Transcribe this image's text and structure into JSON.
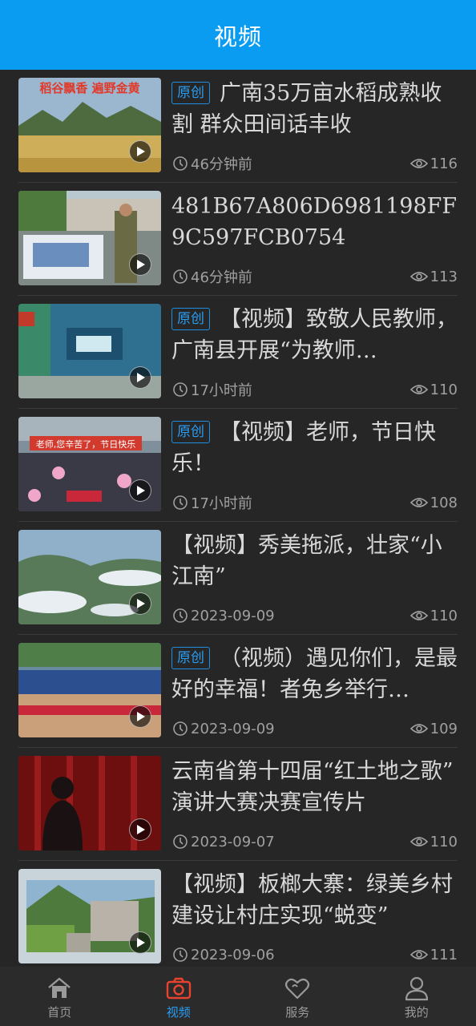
{
  "header": {
    "title": "视频"
  },
  "items": [
    {
      "tag": "原创",
      "title": "广南35万亩水稻成熟收割 群众田间话丰收",
      "time": "46分钟前",
      "views": "116",
      "thumb_text": "稻谷飘香 遍野金黄"
    },
    {
      "tag": "",
      "title": "481B67A806D6981198FF9C597FCB0754",
      "time": "46分钟前",
      "views": "113",
      "thumb_text": ""
    },
    {
      "tag": "原创",
      "title": "【视频】致敬人民教师，广南县开展“为教师…",
      "time": "17小时前",
      "views": "110",
      "thumb_text": ""
    },
    {
      "tag": "原创",
      "title": "【视频】老师，节日快乐！",
      "time": "17小时前",
      "views": "108",
      "thumb_text": "老师,您辛苦了，节日快乐"
    },
    {
      "tag": "",
      "title": "【视频】秀美拖派，壮家“小江南”",
      "time": "2023-09-09",
      "views": "110",
      "thumb_text": ""
    },
    {
      "tag": "原创",
      "title": "（视频）遇见你们，是最好的幸福！者兔乡举行…",
      "time": "2023-09-09",
      "views": "109",
      "thumb_text": ""
    },
    {
      "tag": "",
      "title": "云南省第十四届“红土地之歌” 演讲大赛决赛宣传片",
      "time": "2023-09-07",
      "views": "110",
      "thumb_text": ""
    },
    {
      "tag": "",
      "title": "【视频】板榔大寨：绿美乡村建设让村庄实现“蜕变”",
      "time": "2023-09-06",
      "views": "111",
      "thumb_text": ""
    }
  ],
  "tabbar": [
    {
      "label": "首页",
      "icon": "home-icon",
      "active": false
    },
    {
      "label": "视频",
      "icon": "camera-icon",
      "active": true
    },
    {
      "label": "服务",
      "icon": "heart-icon",
      "active": false
    },
    {
      "label": "我的",
      "icon": "user-icon",
      "active": false
    }
  ],
  "colors": {
    "accent": "#0a9cf0",
    "tab_active": "#e8432e",
    "background": "#262626"
  }
}
